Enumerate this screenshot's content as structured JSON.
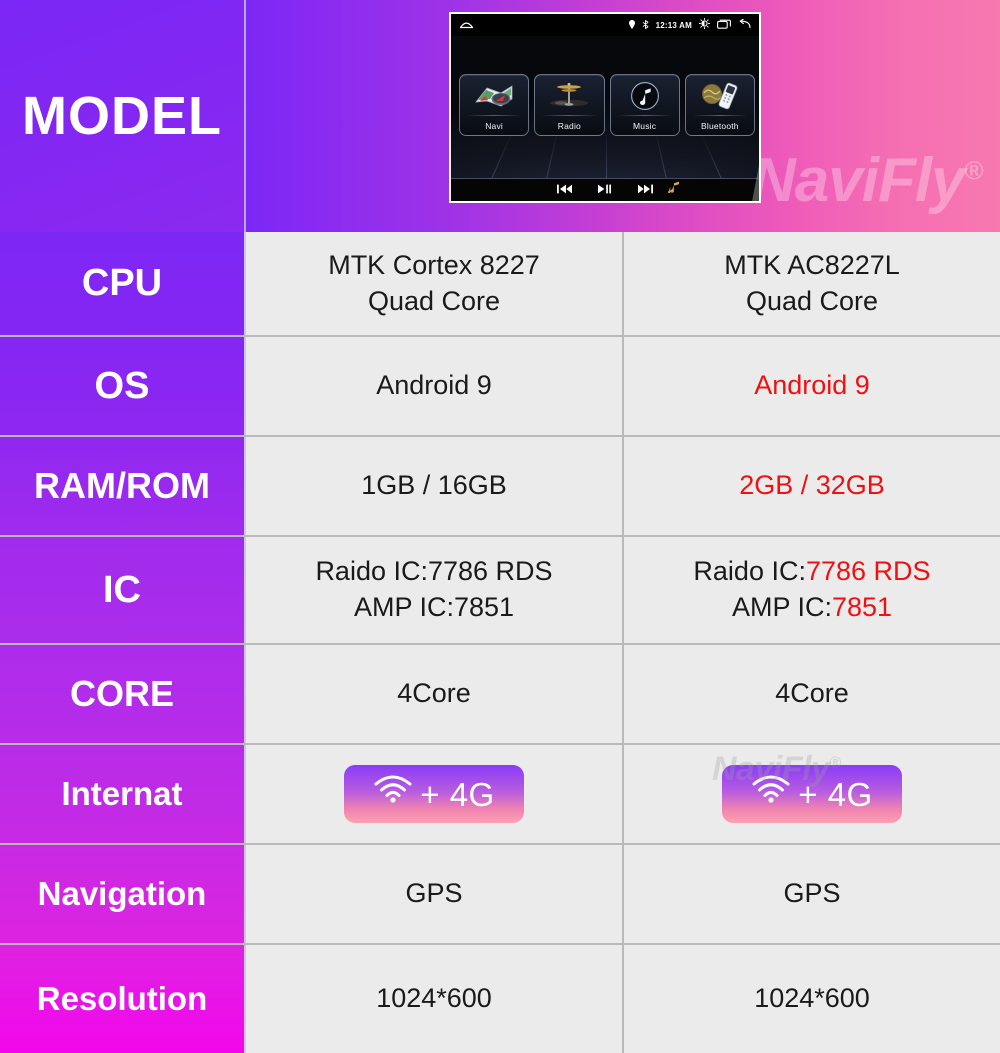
{
  "header": {
    "model_label": "MODEL",
    "watermark": "NaviFly",
    "watermark_mark": "®"
  },
  "device": {
    "statusbar": {
      "home_icon": "home-outline-icon",
      "location_icon": "location-pin-icon",
      "bluetooth_icon": "bluetooth-icon",
      "time": "12:13 AM",
      "brightness_icon": "brightness-icon",
      "recents_icon": "recents-icon",
      "back_icon": "back-arrow-icon"
    },
    "tiles": [
      {
        "label": "Navi",
        "icon": "map-icon"
      },
      {
        "label": "Radio",
        "icon": "antenna-icon"
      },
      {
        "label": "Music",
        "icon": "music-note-icon"
      },
      {
        "label": "Bluetooth",
        "icon": "phone-icon"
      }
    ],
    "media": {
      "prev_icon": "previous-track-icon",
      "play_icon": "play-pause-icon",
      "next_icon": "next-track-icon",
      "note_icon": "music-note-icon"
    }
  },
  "rows": [
    {
      "label": "CPU",
      "left": {
        "lines": [
          "MTK Cortex 8227",
          "Quad Core"
        ],
        "red": false
      },
      "right": {
        "lines": [
          "MTK AC8227L",
          "Quad Core"
        ],
        "red": false
      }
    },
    {
      "label": "OS",
      "left": {
        "lines": [
          "Android 9"
        ],
        "red": false
      },
      "right": {
        "lines": [
          "Android 9"
        ],
        "red": true
      }
    },
    {
      "label": "RAM/ROM",
      "left": {
        "lines": [
          "1GB / 16GB"
        ],
        "red": false
      },
      "right": {
        "lines": [
          "2GB / 32GB"
        ],
        "red": true
      }
    },
    {
      "label": "IC",
      "left": {
        "lines": [
          "Raido IC:7786 RDS",
          "AMP IC:7851"
        ],
        "red": false
      },
      "right": {
        "prefix1": "Raido IC:",
        "value1": "7786 RDS",
        "prefix2": "AMP IC:",
        "value2": "7851",
        "red": true
      }
    },
    {
      "label": "CORE",
      "left": {
        "lines": [
          "4Core"
        ],
        "red": false
      },
      "right": {
        "lines": [
          "4Core"
        ],
        "red": false
      }
    },
    {
      "label": "Internat",
      "left": {
        "badge": {
          "icon": "wifi-icon",
          "text": "+ 4G"
        }
      },
      "right": {
        "badge": {
          "icon": "wifi-icon",
          "text": "+ 4G"
        }
      }
    },
    {
      "label": "Navigation",
      "left": {
        "lines": [
          "GPS"
        ],
        "red": false
      },
      "right": {
        "lines": [
          "GPS"
        ],
        "red": false
      }
    },
    {
      "label": "Resolution",
      "left": {
        "lines": [
          "1024*600"
        ],
        "red": false
      },
      "right": {
        "lines": [
          "1024*600"
        ],
        "red": false
      }
    }
  ],
  "colors": {
    "accent_purple": "#7b27f5",
    "accent_magenta": "#f306ec",
    "highlight_red": "#ee1111",
    "cell_bg": "#ebebeb",
    "border": "#b9b9b9"
  }
}
